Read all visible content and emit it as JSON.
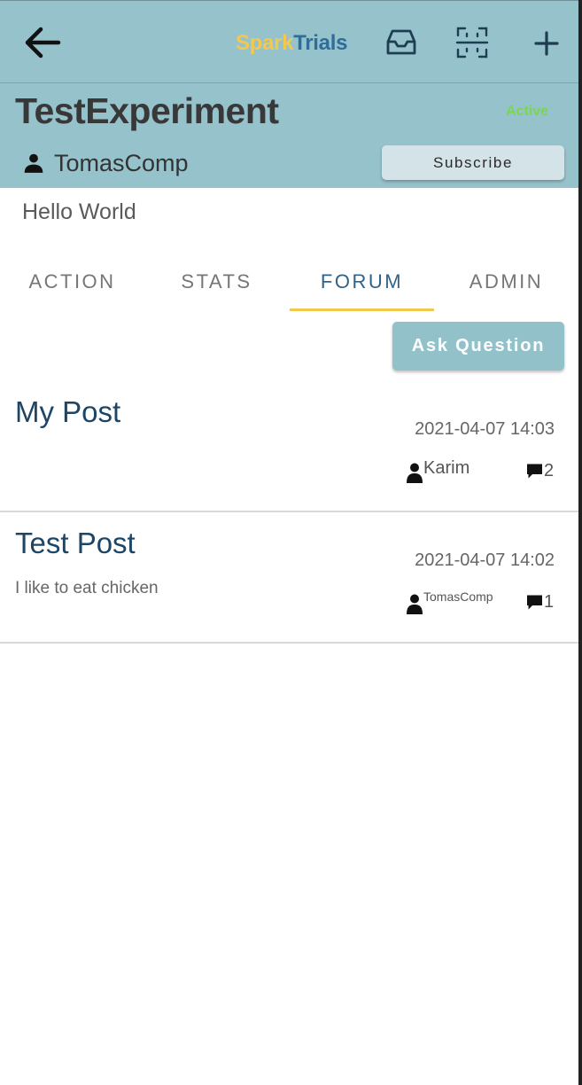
{
  "appbar": {
    "brand_part1": "Spark",
    "brand_part2": "Trials",
    "icons": [
      "back-arrow-icon",
      "inbox-icon",
      "qr-scan-icon",
      "plus-icon"
    ]
  },
  "experiment": {
    "title": "TestExperiment",
    "status": "Active",
    "owner": "TomasComp",
    "subscribe_label": "Subscribe",
    "description": "Hello World"
  },
  "tabs": [
    {
      "label": "ACTION",
      "active": false
    },
    {
      "label": "STATS",
      "active": false
    },
    {
      "label": "FORUM",
      "active": true
    },
    {
      "label": "ADMIN",
      "active": false
    }
  ],
  "forum": {
    "ask_label": "Ask Question",
    "posts": [
      {
        "title": "My Post",
        "body": "",
        "date": "2021-04-07 14:03",
        "author": "Karim",
        "comments": "2"
      },
      {
        "title": "Test Post",
        "body": "I like to eat chicken",
        "date": "2021-04-07 14:02",
        "author": "TomasComp",
        "comments": "1"
      }
    ]
  },
  "colors": {
    "header_bg": "#96c2cb",
    "brand_yellow": "#f2c94c",
    "brand_blue": "#2f6d9b",
    "active_status": "#7bd64f",
    "tab_indicator": "#f2c94c",
    "post_title": "#1d4566"
  }
}
